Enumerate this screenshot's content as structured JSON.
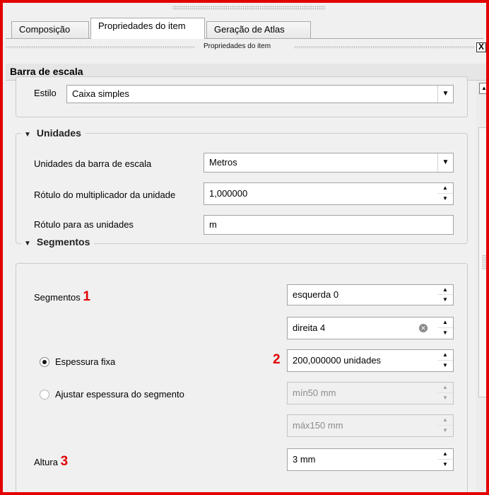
{
  "tabs": [
    {
      "label": "Composição"
    },
    {
      "label": "Propriedades do item"
    },
    {
      "label": "Geração de Atlas"
    }
  ],
  "dock": {
    "title": "Propriedades do item",
    "close": "X"
  },
  "section": {
    "title": "Barra de escala"
  },
  "estilo": {
    "label": "Estilo",
    "value": "Caixa simples"
  },
  "unidades": {
    "title": "Unidades",
    "unit_label": "Unidades da barra de escala",
    "unit_value": "Metros",
    "multiplier_label": "Rótulo do multiplicador da unidade",
    "multiplier_value": "1,000000",
    "units_label_label": "Rótulo para as unidades",
    "units_label_value": "m"
  },
  "segmentos": {
    "title": "Segmentos",
    "segments_label": "Segmentos",
    "left_value": "esquerda 0",
    "right_value": "direita 4",
    "fixed_width_label": "Espessura fixa",
    "fixed_width_value": "200,000000 unidades",
    "fit_width_label": "Ajustar espessura do segmento",
    "min_value": "mín50 mm",
    "max_value": "máx150 mm",
    "height_label": "Altura",
    "height_value": "3 mm"
  },
  "markers": {
    "one": "1",
    "two": "2",
    "three": "3"
  },
  "icons": {
    "collapse": "triangle-down-icon",
    "dropdown": "chevron-down-icon",
    "spin_up": "spin-up-icon",
    "spin_down": "spin-down-icon",
    "clear": "clear-icon"
  },
  "colors": {
    "frame": "#e30000",
    "marker": "#e00000"
  }
}
